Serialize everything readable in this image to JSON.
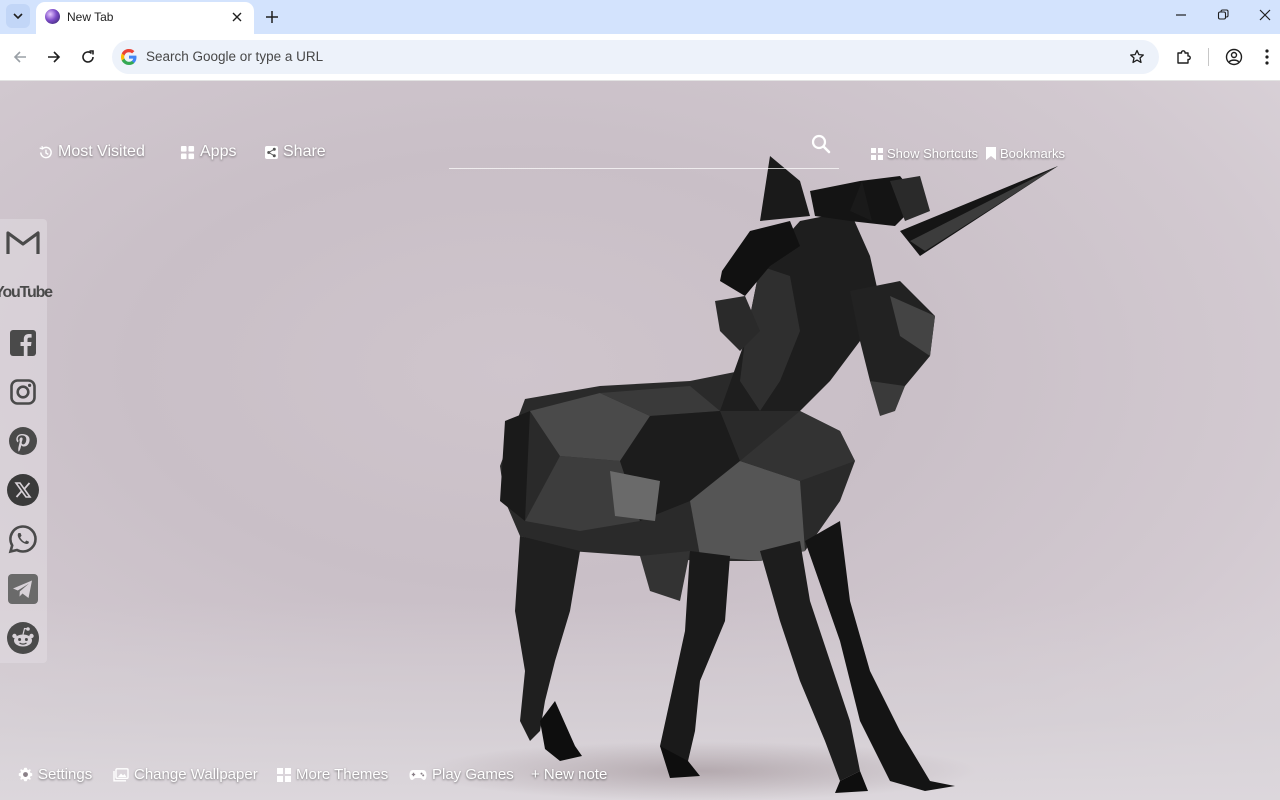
{
  "browser": {
    "tab_title": "New Tab",
    "omnibox_placeholder": "Search Google or type a URL"
  },
  "header_links": {
    "most_visited": "Most Visited",
    "apps": "Apps",
    "share": "Share",
    "show_shortcuts": "Show Shortcuts",
    "bookmarks": "Bookmarks"
  },
  "sidebar": {
    "items": [
      {
        "name": "Gmail",
        "icon": "gmail-icon"
      },
      {
        "name": "YouTube",
        "label": "YouTube",
        "icon": "youtube-icon"
      },
      {
        "name": "Facebook",
        "icon": "facebook-icon"
      },
      {
        "name": "Instagram",
        "icon": "instagram-icon"
      },
      {
        "name": "Pinterest",
        "icon": "pinterest-icon"
      },
      {
        "name": "X",
        "icon": "x-icon"
      },
      {
        "name": "WhatsApp",
        "icon": "whatsapp-icon"
      },
      {
        "name": "Telegram",
        "icon": "telegram-icon"
      },
      {
        "name": "Reddit",
        "icon": "reddit-icon"
      }
    ]
  },
  "footer": {
    "settings": "Settings",
    "change_wallpaper": "Change Wallpaper",
    "more_themes": "More Themes",
    "play_games": "Play Games",
    "new_note": "+ New note"
  },
  "colors": {
    "tabstrip_bg": "#d3e3fd",
    "omnibox_bg": "#edf2fa",
    "sidebar_icon": "#4a4a4a"
  }
}
